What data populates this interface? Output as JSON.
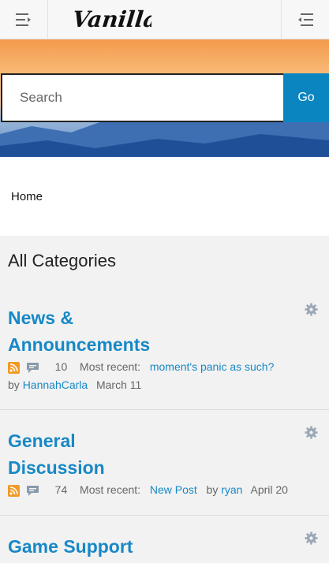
{
  "header": {
    "logo_text": "Vanilla"
  },
  "search": {
    "placeholder": "Search",
    "button_label": "Go"
  },
  "breadcrumb": {
    "home_label": "Home"
  },
  "page_title": "All Categories",
  "categories": [
    {
      "title_line1": "News &",
      "title_line2": "Announcements",
      "count": "10",
      "recent_label": "Most recent:",
      "recent_link": "moment's panic as such?",
      "by_label": "by",
      "author": "HannahCarla",
      "date": "March 11"
    },
    {
      "title_line1": "General",
      "title_line2": "Discussion",
      "count": "74",
      "recent_label": "Most recent:",
      "recent_link": "New Post",
      "by_label": "by",
      "author": "ryan",
      "date": "April 20"
    },
    {
      "title_line1": "Game Support"
    }
  ],
  "colors": {
    "link": "#1788c6",
    "go_button": "#0b85c0",
    "rss": "#f39a22"
  }
}
